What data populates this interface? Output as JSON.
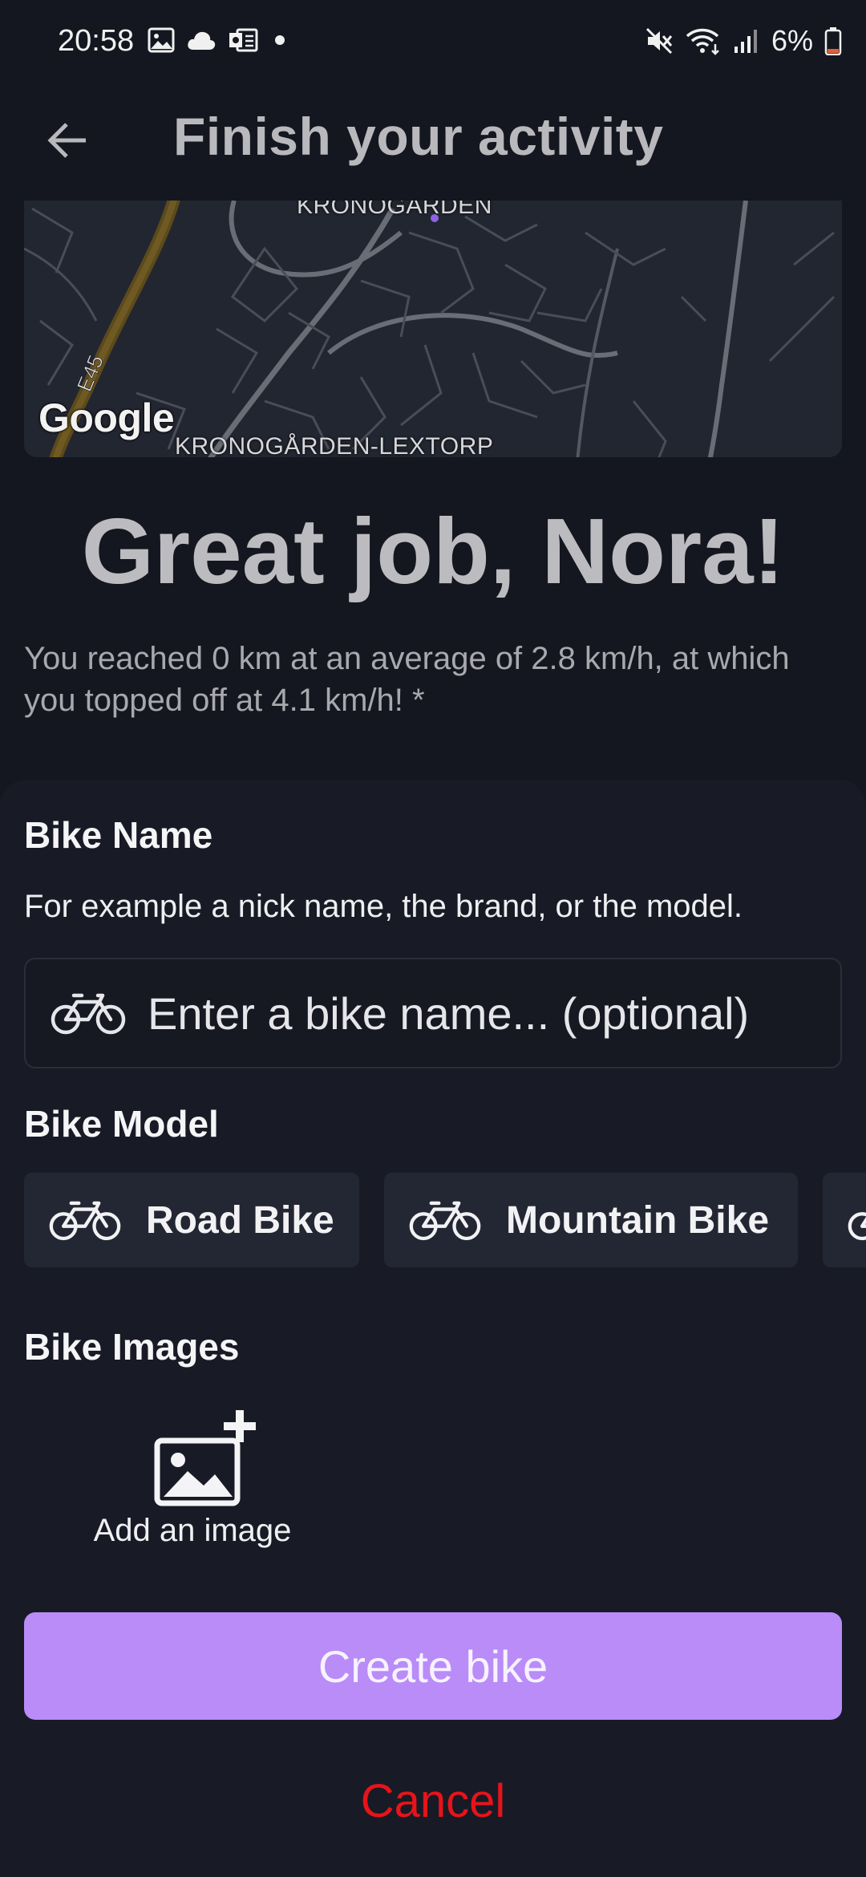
{
  "status_bar": {
    "time": "20:58",
    "battery": "6%",
    "icons_left": [
      "gallery-icon",
      "cloud-icon",
      "outlook-icon",
      "dot-icon"
    ],
    "icons_right": [
      "mute-icon",
      "wifi-icon",
      "signal-icon",
      "battery-icon"
    ],
    "battery_color": "#e0603a"
  },
  "app_bar": {
    "title": "Finish your activity",
    "back_icon": "arrow-left-icon"
  },
  "map": {
    "attribution": "Google",
    "label_bottom": "KRONOGÅRDEN-LEXTORP",
    "label_top": "KRONOGÅRDEN",
    "road_label": "E45"
  },
  "greeting": "Great job, Nora!",
  "summary": "You reached 0 km at an average of 2.8 km/h, at which you topped off at 4.1 km/h! *",
  "sheet": {
    "bike_name_label": "Bike Name",
    "bike_name_helper": "For example a nick name, the brand, or the model.",
    "bike_name_placeholder": "Enter a bike name... (optional)",
    "bike_model_label": "Bike Model",
    "models": [
      {
        "label": "Road Bike",
        "icon": "bicycle-icon"
      },
      {
        "label": "Mountain Bike",
        "icon": "bicycle-icon"
      },
      {
        "label": "",
        "icon": "bicycle-icon"
      }
    ],
    "bike_images_label": "Bike Images",
    "add_image_label": "Add an image",
    "create_button": "Create bike",
    "cancel_button": "Cancel"
  },
  "colors": {
    "background": "#141720",
    "sheet": "#181b25",
    "accent": "#b98cf8",
    "cancel": "#e8131a"
  }
}
